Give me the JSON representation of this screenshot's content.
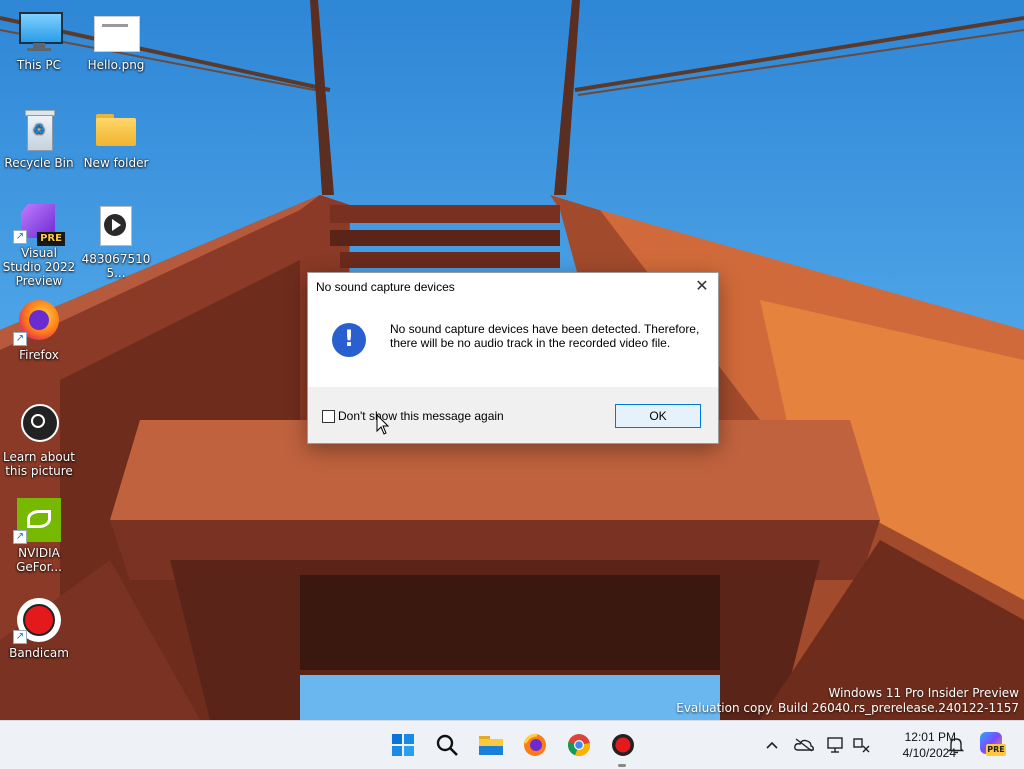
{
  "desktop": {
    "icons": [
      {
        "label": "This PC"
      },
      {
        "label": "Hello.png"
      },
      {
        "label": "Recycle Bin"
      },
      {
        "label": "New folder"
      },
      {
        "label": "Visual Studio 2022 Preview"
      },
      {
        "label": "4830675105..."
      },
      {
        "label": "Firefox"
      },
      {
        "label": "Learn about this picture"
      },
      {
        "label": "NVIDIA GeFor..."
      },
      {
        "label": "Bandicam"
      }
    ],
    "vs_badge": "PRE"
  },
  "watermark": {
    "line1": "Windows 11 Pro Insider Preview",
    "line2": "Evaluation copy. Build 26040.rs_prerelease.240122-1157"
  },
  "dialog": {
    "title": "No sound capture devices",
    "message": "No sound capture devices have been detected. Therefore, there will be no audio track in the recorded video file.",
    "checkbox_label": "Don't show this message again",
    "checkbox_checked": false,
    "ok_label": "OK"
  },
  "taskbar": {
    "apps": [
      "start-icon",
      "search-icon",
      "file-explorer-icon",
      "firefox-icon",
      "chrome-icon",
      "bandicam-icon"
    ],
    "tray": [
      "chevron-up-icon",
      "onedrive-icon",
      "display-icon",
      "network-icon",
      "notification-icon",
      "copilot-icon"
    ],
    "copilot_badge": "PRE",
    "time": "12:01 PM",
    "date": "4/10/2024"
  }
}
